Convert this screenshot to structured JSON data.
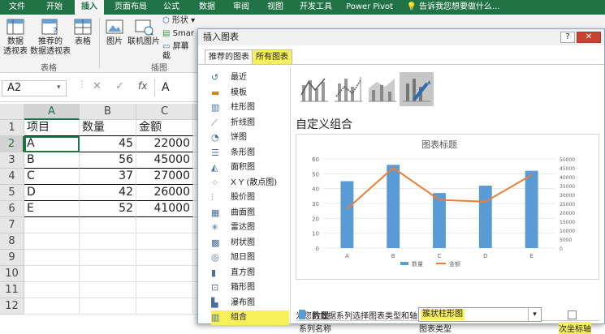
{
  "ribbon_tabs": [
    "文件",
    "开始",
    "插入",
    "页面布局",
    "公式",
    "数据",
    "审阅",
    "视图",
    "开发工具",
    "Power Pivot"
  ],
  "active_tab": "插入",
  "tell_me": "告诉我您想要做什么...",
  "ribbon": {
    "pivot_table": "数据\n透视表",
    "recommended_pivot": "推荐的\n数据透视表",
    "table": "表格",
    "group_tables": "表格",
    "pictures": "图片",
    "online_pictures": "联机图片",
    "shapes": "形状",
    "smartart": "Smar",
    "screenshot": "屏幕截",
    "group_illustrations": "插图"
  },
  "formula_bar": {
    "name_box": "A2",
    "fx": "fx",
    "content": "A"
  },
  "sheet": {
    "columns": [
      "A",
      "B",
      "C"
    ],
    "rows": [
      "1",
      "2",
      "3",
      "4",
      "5",
      "6",
      "7",
      "8",
      "9",
      "10",
      "11",
      "12"
    ],
    "header_row": [
      "项目",
      "数量",
      "金额"
    ],
    "data": [
      [
        "A",
        "45",
        "22000"
      ],
      [
        "B",
        "56",
        "45000"
      ],
      [
        "C",
        "37",
        "27000"
      ],
      [
        "D",
        "42",
        "26000"
      ],
      [
        "E",
        "52",
        "41000"
      ]
    ]
  },
  "dialog": {
    "title": "插入图表",
    "help": "?",
    "close": "✕",
    "tabs": [
      "推荐的图表",
      "所有图表"
    ],
    "chart_types": [
      "最近",
      "模板",
      "柱形图",
      "折线图",
      "饼图",
      "条形图",
      "面积图",
      "X Y (散点图)",
      "股价图",
      "曲面图",
      "雷达图",
      "树状图",
      "旭日图",
      "直方图",
      "箱形图",
      "瀑布图",
      "组合"
    ],
    "active_type": "组合",
    "combo_heading": "自定义组合",
    "prompt": "为您的数据系列选择图表类型和轴:",
    "table_headers": [
      "系列名称",
      "图表类型",
      "次坐标轴"
    ],
    "series_row": {
      "name": "数量",
      "type": "簇状柱形图"
    }
  },
  "chart_data": {
    "type": "bar",
    "title": "图表标题",
    "categories": [
      "A",
      "B",
      "C",
      "D",
      "E"
    ],
    "series": [
      {
        "name": "数量",
        "type": "bar",
        "axis": "primary",
        "values": [
          45,
          56,
          37,
          42,
          52
        ],
        "color": "#5b9bd5"
      },
      {
        "name": "金额",
        "type": "line",
        "axis": "secondary",
        "values": [
          22000,
          45000,
          27000,
          26000,
          41000
        ],
        "color": "#ed7d31"
      }
    ],
    "y_ticks": [
      "0",
      "10",
      "20",
      "30",
      "40",
      "50",
      "60"
    ],
    "y2_ticks": [
      "0",
      "5000",
      "10000",
      "15000",
      "20000",
      "25000",
      "30000",
      "35000",
      "40000",
      "45000",
      "50000"
    ],
    "ylim": [
      0,
      60
    ],
    "y2lim": [
      0,
      50000
    ],
    "grid": true,
    "legend": "bottom"
  },
  "colors": {
    "excel_green": "#217346",
    "highlight": "#f8f05a",
    "bar": "#5b9bd5",
    "line": "#ed7d31"
  }
}
